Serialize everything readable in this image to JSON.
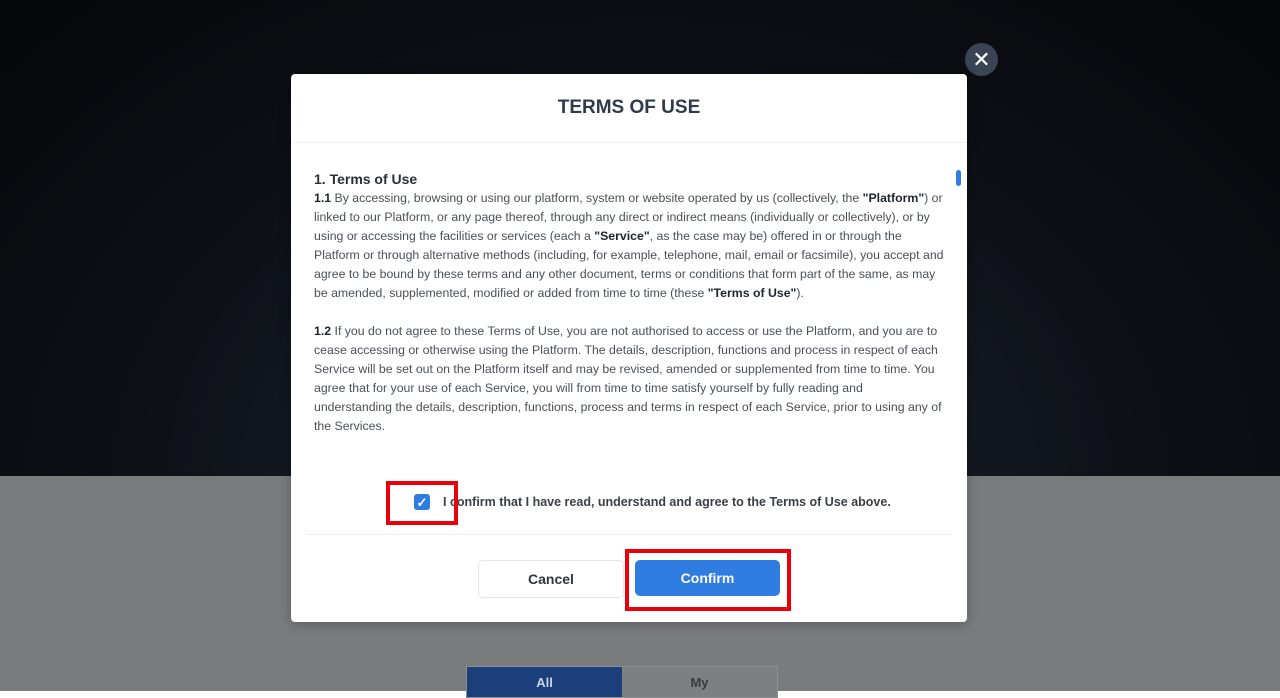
{
  "background": {
    "tabs": [
      {
        "label": "All",
        "active": true
      },
      {
        "label": "My",
        "active": false
      }
    ]
  },
  "modal": {
    "title": "TERMS OF USE",
    "close_icon": "close-icon",
    "section_heading": "1. Terms of Use",
    "p1": {
      "num": "1.1",
      "t1": " By accessing, browsing or using our platform, system or website operated by us (collectively, the ",
      "b1": "\"Platform\"",
      "t2": ") or linked to our Platform, or any page thereof, through any direct or indirect means (individually or collectively), or by using or accessing the facilities or services (each a ",
      "b2": "\"Service\"",
      "t3": ", as the case may be) offered in or through the Platform or through alternative methods (including, for example, telephone, mail, email or facsimile), you accept and agree to be bound by these terms and any other document, terms or conditions that form part of the same, as may be amended, supplemented, modified or added from time to time (these ",
      "b3": "\"Terms of Use\"",
      "t4": ")."
    },
    "p2": {
      "num": "1.2",
      "text": " If you do not agree to these Terms of Use, you are not authorised to access or use the Platform, and you are to cease accessing or otherwise using the Platform. The details, description, functions and process in respect of each Service will be set out on the Platform itself and may be revised, amended or supplemented from time to time. You agree that for your use of each Service, you will from time to time satisfy yourself by fully reading and understanding the details, description, functions, process and terms in respect of each Service, prior to using any of the Services."
    },
    "checkbox_checked": true,
    "checkbox_label": "I confirm that I have read, understand and agree to the Terms of Use above.",
    "cancel_label": "Cancel",
    "confirm_label": "Confirm"
  },
  "colors": {
    "accent": "#2f7de1",
    "highlight": "#e8000b"
  }
}
